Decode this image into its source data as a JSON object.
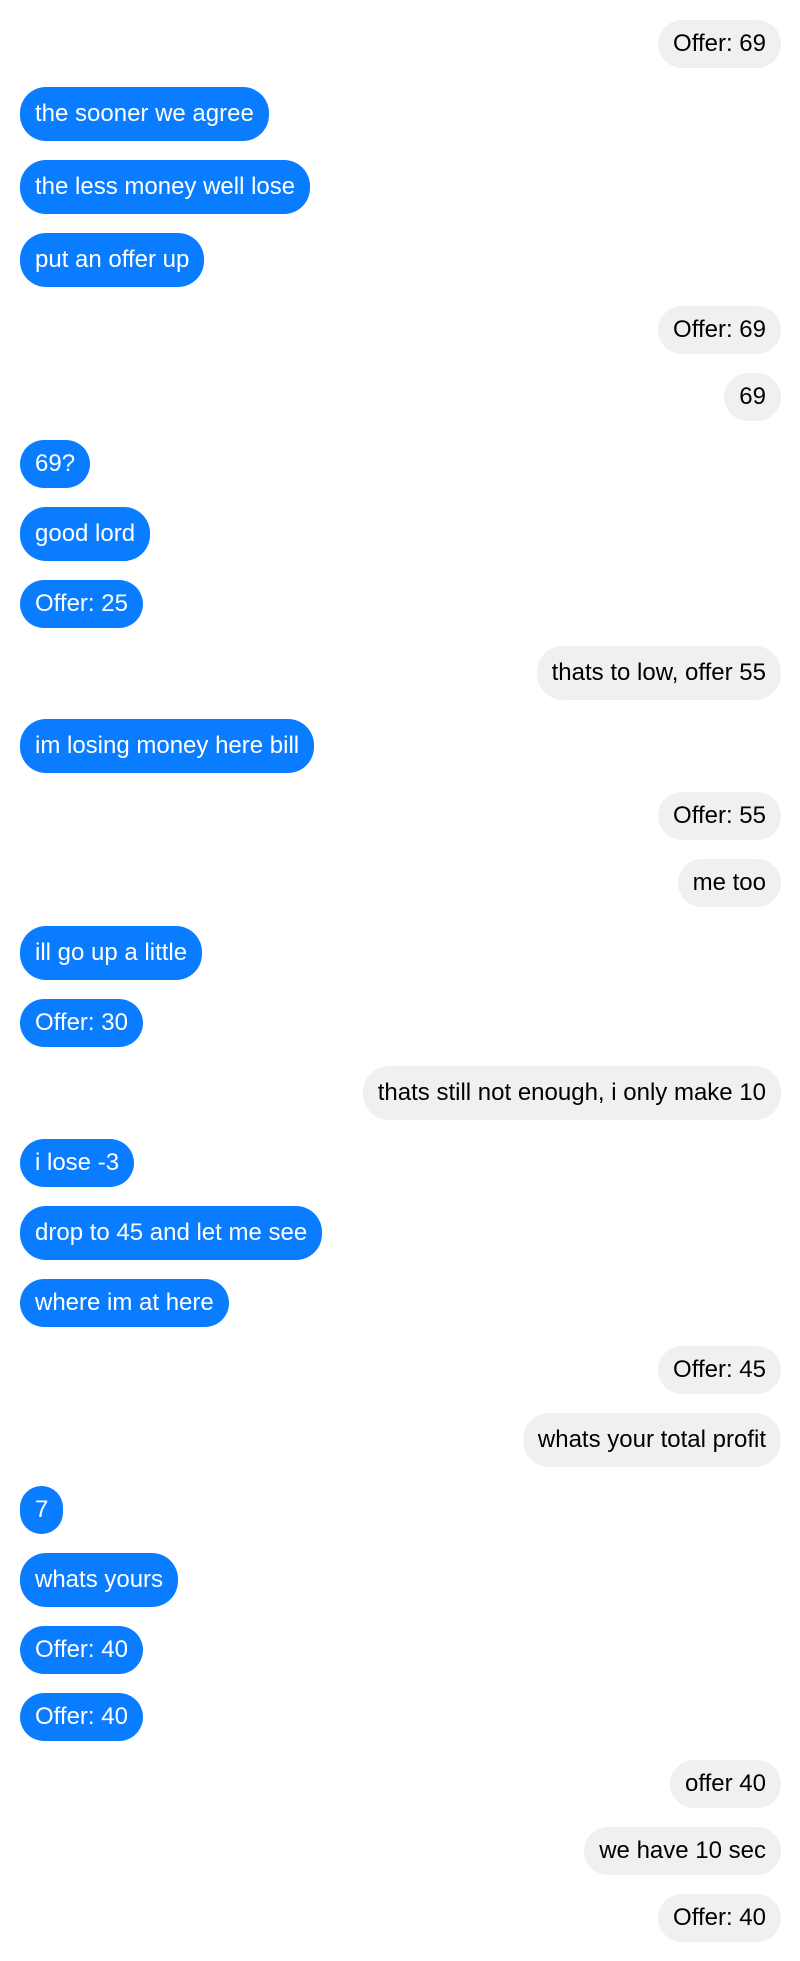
{
  "colors": {
    "left_bubble": "#0a7cff",
    "left_text": "#ffffff",
    "right_bubble": "#f0f0f0",
    "right_text": "#000000",
    "background": "#ffffff"
  },
  "messages": [
    {
      "side": "right",
      "text": "Offer: 69"
    },
    {
      "side": "left",
      "text": "the sooner we agree"
    },
    {
      "side": "left",
      "text": "the less money well lose"
    },
    {
      "side": "left",
      "text": "put an offer up"
    },
    {
      "side": "right",
      "text": "Offer: 69"
    },
    {
      "side": "right",
      "text": "69"
    },
    {
      "side": "left",
      "text": "69?"
    },
    {
      "side": "left",
      "text": "good lord"
    },
    {
      "side": "left",
      "text": "Offer: 25"
    },
    {
      "side": "right",
      "text": "thats to low, offer 55"
    },
    {
      "side": "left",
      "text": "im losing money here bill"
    },
    {
      "side": "right",
      "text": "Offer: 55"
    },
    {
      "side": "right",
      "text": "me too"
    },
    {
      "side": "left",
      "text": "ill go up a little"
    },
    {
      "side": "left",
      "text": "Offer: 30"
    },
    {
      "side": "right",
      "text": "thats still not enough, i only make 10"
    },
    {
      "side": "left",
      "text": "i lose -3"
    },
    {
      "side": "left",
      "text": "drop to 45 and let me see"
    },
    {
      "side": "left",
      "text": "where im at here"
    },
    {
      "side": "right",
      "text": "Offer: 45"
    },
    {
      "side": "right",
      "text": "whats your total profit"
    },
    {
      "side": "left",
      "text": "7"
    },
    {
      "side": "left",
      "text": "whats yours"
    },
    {
      "side": "left",
      "text": "Offer: 40"
    },
    {
      "side": "left",
      "text": "Offer: 40"
    },
    {
      "side": "right",
      "text": "offer 40"
    },
    {
      "side": "right",
      "text": "we have 10 sec"
    },
    {
      "side": "right",
      "text": "Offer: 40"
    }
  ]
}
